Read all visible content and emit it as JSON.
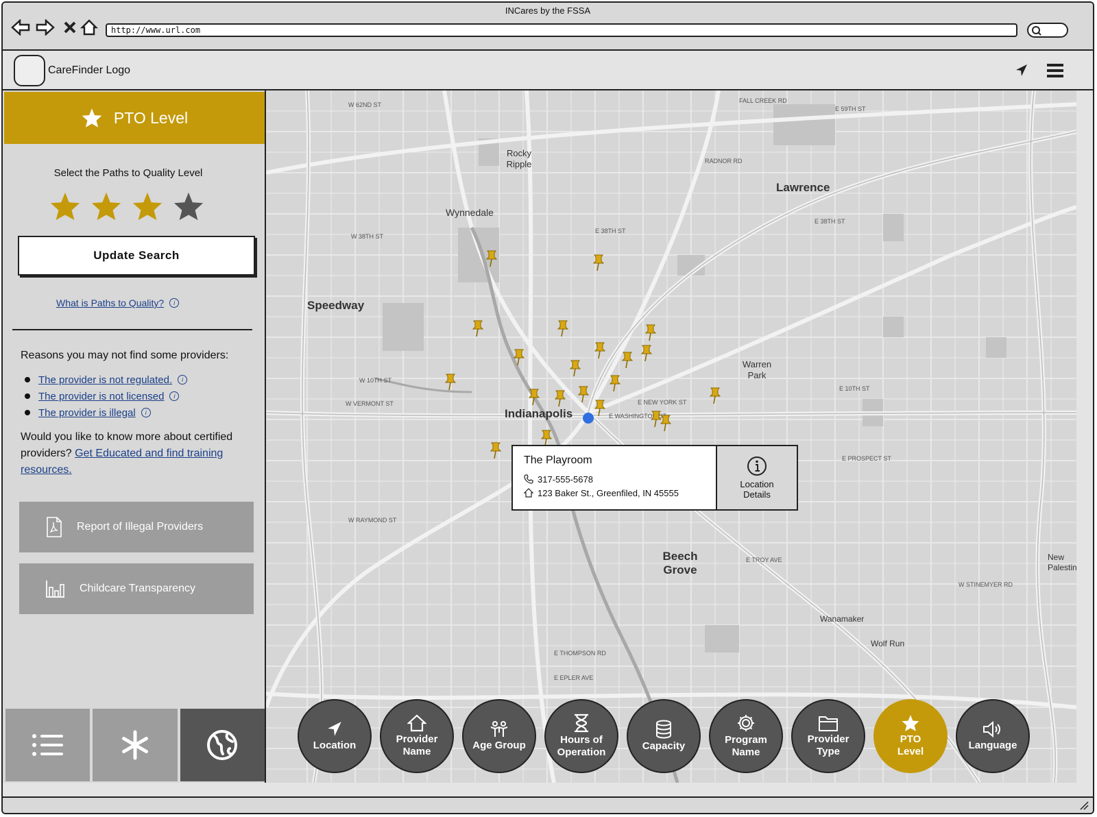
{
  "window": {
    "title": "INCares by the FSSA",
    "url": "http://www.url.com"
  },
  "header": {
    "logo_text": "CareFinder Logo",
    "icons": [
      "location-arrow-icon",
      "hamburger-menu-icon"
    ]
  },
  "panel": {
    "title": "PTO Level",
    "select_label": "Select the Paths to Quality Level",
    "stars_total": 4,
    "stars_selected": 3,
    "update_button": "Update Search",
    "ptq_link": "What is Paths to Quality?",
    "reasons_title": "Reasons you may not find some providers:",
    "reasons": [
      "The provider is not regulated.",
      "The provider is not licensed",
      "The provider is illegal"
    ],
    "know_more_text": "Would you like to know more about certified providers?",
    "know_more_link": "Get Educated and find training resources.",
    "report_button": "Report of Illegal Providers",
    "transparency_button": "Childcare Transparency",
    "tabs": [
      "list-icon",
      "asterisk-icon",
      "globe-icon"
    ]
  },
  "map": {
    "cities": [
      "Indianapolis",
      "Speedway",
      "Lawrence",
      "Beech Grove",
      "Warren Park",
      "Wynnedale",
      "Rocky Ripple",
      "Wanamaker",
      "Wolf Run",
      "New Palestine"
    ],
    "popup": {
      "name": "The Playroom",
      "phone": "317-555-5678",
      "address": "123 Baker St., Greenfiled, IN 45555",
      "details_label": "Location Details"
    }
  },
  "filters": [
    {
      "label": "Location",
      "icon": "location-arrow-icon",
      "active": false
    },
    {
      "label": "Provider Name",
      "icon": "home-icon",
      "active": false
    },
    {
      "label": "Age Group",
      "icon": "people-icon",
      "active": false
    },
    {
      "label": "Hours of Operation",
      "icon": "hourglass-icon",
      "active": false
    },
    {
      "label": "Capacity",
      "icon": "database-icon",
      "active": false
    },
    {
      "label": "Program Name",
      "icon": "gear-icon",
      "active": false
    },
    {
      "label": "Provider Type",
      "icon": "folder-icon",
      "active": false
    },
    {
      "label": "PTO Level",
      "icon": "star-icon",
      "active": true
    },
    {
      "label": "Language",
      "icon": "speaker-icon",
      "active": false
    }
  ],
  "colors": {
    "accent": "#c49a0a",
    "link": "#1a3f8a",
    "dark_button": "#555555",
    "grey_button": "#9d9d9d"
  }
}
